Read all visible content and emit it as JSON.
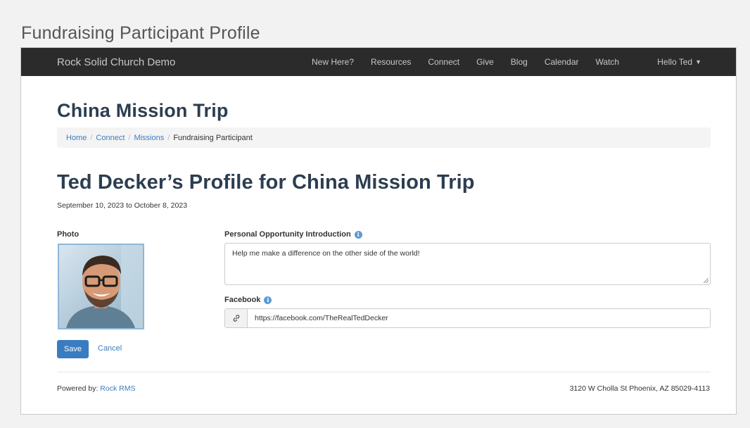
{
  "outer_title": "Fundraising Participant Profile",
  "navbar": {
    "brand": "Rock Solid Church Demo",
    "links": [
      "New Here?",
      "Resources",
      "Connect",
      "Give",
      "Blog",
      "Calendar",
      "Watch"
    ],
    "user_menu": "Hello Ted"
  },
  "page": {
    "heading": "China Mission Trip",
    "breadcrumb": [
      "Home",
      "Connect",
      "Missions",
      "Fundraising Participant"
    ]
  },
  "profile": {
    "title": "Ted Decker’s Profile for China Mission Trip",
    "date_range": "September 10, 2023 to October 8, 2023",
    "photo_label": "Photo",
    "intro_label": "Personal Opportunity Introduction",
    "intro_value": "Help me make a difference on the other side of the world!",
    "facebook_label": "Facebook",
    "facebook_value": "https://facebook.com/TheRealTedDecker",
    "link_icon": "link-icon",
    "info_icon": "info-icon"
  },
  "actions": {
    "save_label": "Save",
    "cancel_label": "Cancel"
  },
  "footer": {
    "powered_prefix": "Powered by: ",
    "powered_link": "Rock RMS",
    "address": "3120 W Cholla St Phoenix, AZ 85029-4113"
  },
  "colors": {
    "navbar_bg": "#2b2b2b",
    "link": "#3a7cc0",
    "heading": "#2c3e50",
    "primary_button": "#3a7cc0"
  }
}
